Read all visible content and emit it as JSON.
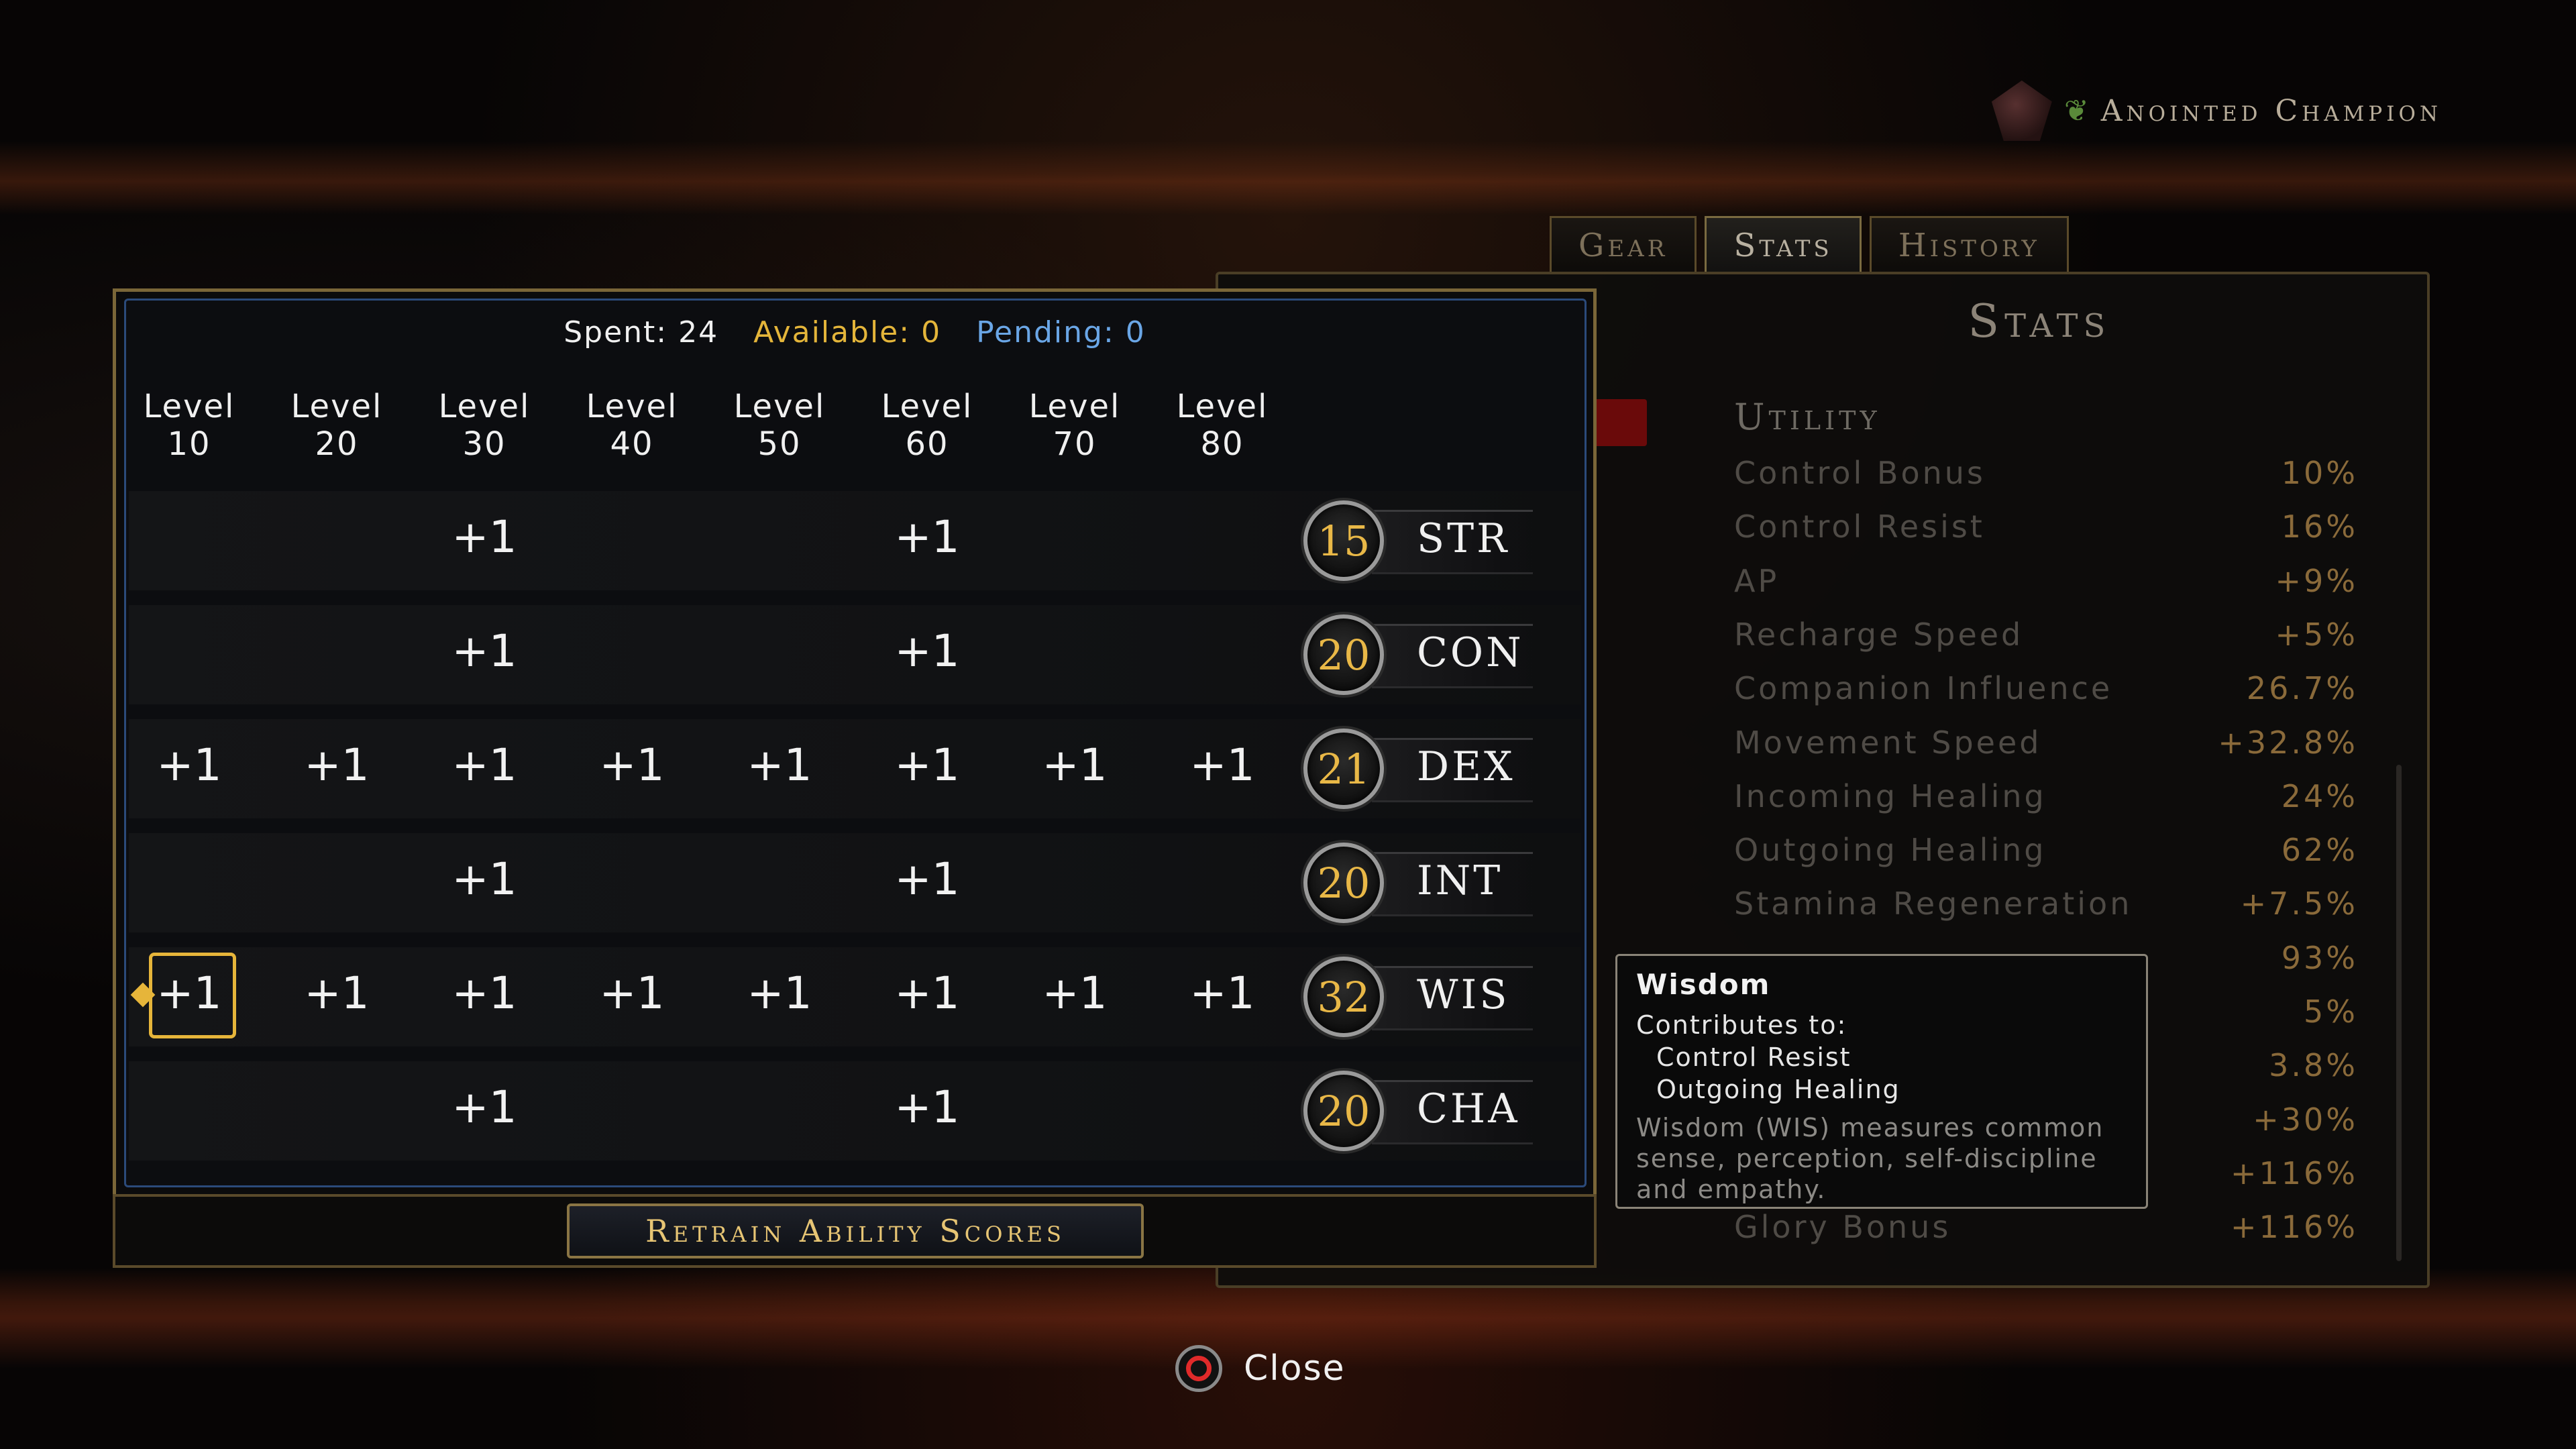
{
  "character": {
    "title": "Anointed Champion"
  },
  "tabs": [
    {
      "label": "Gear",
      "active": false
    },
    {
      "label": "Stats",
      "active": true
    },
    {
      "label": "History",
      "active": false
    }
  ],
  "stats_panel": {
    "heading": "Stats",
    "section": "Utility",
    "rows": [
      {
        "name": "Control Bonus",
        "value": "10%"
      },
      {
        "name": "Control Resist",
        "value": "16%"
      },
      {
        "name": "AP",
        "value": "+9%"
      },
      {
        "name": "Recharge Speed",
        "value": "+5%"
      },
      {
        "name": "Companion Influence",
        "value": "26.7%"
      },
      {
        "name": "Movement Speed",
        "value": "+32.8%"
      },
      {
        "name": "Incoming Healing",
        "value": "24%"
      },
      {
        "name": "Outgoing Healing",
        "value": "62%"
      },
      {
        "name": "Stamina Regeneration",
        "value": "+7.5%"
      },
      {
        "name": "",
        "value": "93%"
      },
      {
        "name": "",
        "value": "5%"
      },
      {
        "name": "",
        "value": "3.8%"
      },
      {
        "name": "",
        "value": "+30%"
      },
      {
        "name": "",
        "value": "+116%"
      },
      {
        "name": "Glory Bonus",
        "value": "+116%"
      }
    ]
  },
  "ability_scores": {
    "spent_label": "Spent: 24",
    "available_label": "Available: 0",
    "pending_label": "Pending: 0",
    "level_headers": [
      {
        "line1": "Level",
        "line2": "10"
      },
      {
        "line1": "Level",
        "line2": "20"
      },
      {
        "line1": "Level",
        "line2": "30"
      },
      {
        "line1": "Level",
        "line2": "40"
      },
      {
        "line1": "Level",
        "line2": "50"
      },
      {
        "line1": "Level",
        "line2": "60"
      },
      {
        "line1": "Level",
        "line2": "70"
      },
      {
        "line1": "Level",
        "line2": "80"
      }
    ],
    "rows": [
      {
        "ability": "STR",
        "score": "15",
        "cells": [
          "",
          "",
          "+1",
          "",
          "",
          "+1",
          "",
          ""
        ]
      },
      {
        "ability": "CON",
        "score": "20",
        "cells": [
          "",
          "",
          "+1",
          "",
          "",
          "+1",
          "",
          ""
        ]
      },
      {
        "ability": "DEX",
        "score": "21",
        "cells": [
          "+1",
          "+1",
          "+1",
          "+1",
          "+1",
          "+1",
          "+1",
          "+1"
        ]
      },
      {
        "ability": "INT",
        "score": "20",
        "cells": [
          "",
          "",
          "+1",
          "",
          "",
          "+1",
          "",
          ""
        ]
      },
      {
        "ability": "WIS",
        "score": "32",
        "cells": [
          "+1",
          "+1",
          "+1",
          "+1",
          "+1",
          "+1",
          "+1",
          "+1"
        ]
      },
      {
        "ability": "CHA",
        "score": "20",
        "cells": [
          "",
          "",
          "+1",
          "",
          "",
          "+1",
          "",
          ""
        ]
      }
    ],
    "selected": {
      "row": 4,
      "col": 0
    },
    "retrain_label": "Retrain Ability Scores"
  },
  "tooltip": {
    "title": "Wisdom",
    "contributes_label": "Contributes to:",
    "contributes": [
      "Control Resist",
      "Outgoing Healing"
    ],
    "description": "Wisdom (WIS) measures common sense, perception, self-discipline and empathy."
  },
  "footer": {
    "close_label": "Close"
  },
  "colors": {
    "gold": "#e4b53a",
    "blue": "#6aa6e6",
    "panel_border": "#7a6638"
  }
}
